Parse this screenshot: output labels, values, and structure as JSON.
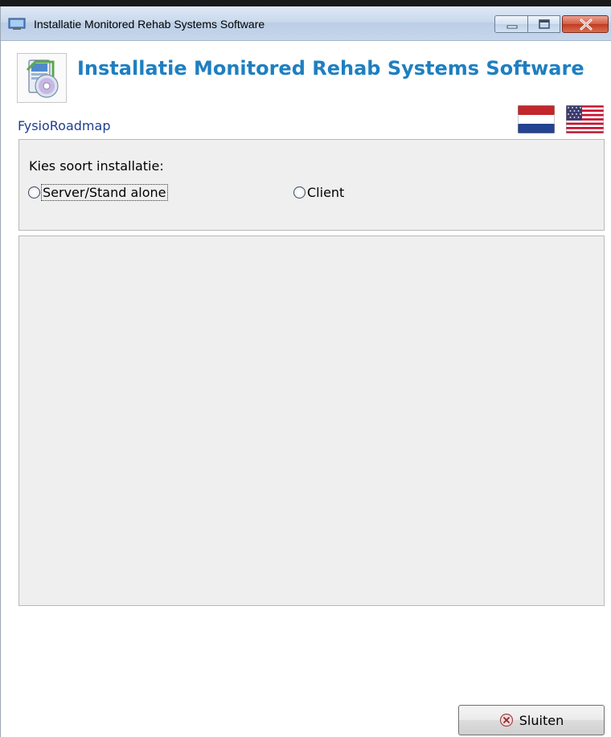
{
  "window": {
    "title": "Installatie Monitored Rehab Systems Software"
  },
  "header": {
    "title": "Installatie Monitored Rehab Systems Software",
    "brand": "FysioRoadmap"
  },
  "languages": [
    {
      "name": "nl-flag-icon",
      "lang": "Nederlands"
    },
    {
      "name": "us-flag-icon",
      "lang": "English"
    }
  ],
  "installation": {
    "label": "Kies soort installatie:",
    "options": [
      {
        "label": "Server/Stand alone",
        "selected": false,
        "focused": true
      },
      {
        "label": "Client",
        "selected": false,
        "focused": false
      }
    ]
  },
  "footer": {
    "close_label": "Sluiten"
  },
  "colors": {
    "header_title": "#1e7fc1",
    "brand": "#1f3f8f",
    "panel_bg": "#efefef"
  }
}
